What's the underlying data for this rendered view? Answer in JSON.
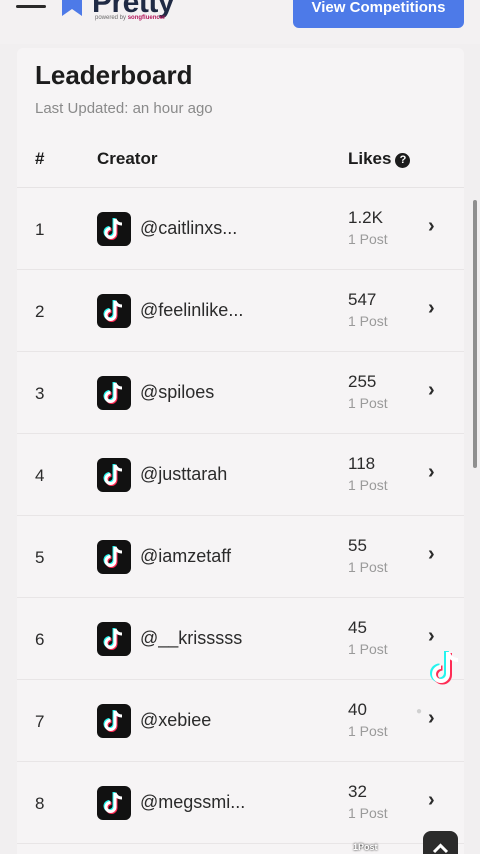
{
  "header": {
    "logo_text": "Pretty",
    "logo_sub_prefix": "powered by",
    "logo_sub_brand": "songfluencer",
    "view_button": "View Competitions"
  },
  "leaderboard": {
    "title": "Leaderboard",
    "updated": "Last Updated: an hour ago",
    "columns": {
      "rank": "#",
      "creator": "Creator",
      "likes": "Likes"
    },
    "rows": [
      {
        "rank": "1",
        "creator": "@caitlinxs...",
        "likes": "1.2K",
        "posts": "1 Post"
      },
      {
        "rank": "2",
        "creator": "@feelinlike...",
        "likes": "547",
        "posts": "1 Post"
      },
      {
        "rank": "3",
        "creator": "@spiloes",
        "likes": "255",
        "posts": "1 Post"
      },
      {
        "rank": "4",
        "creator": "@justtarah",
        "likes": "118",
        "posts": "1 Post"
      },
      {
        "rank": "5",
        "creator": "@iamzetaff",
        "likes": "55",
        "posts": "1 Post"
      },
      {
        "rank": "6",
        "creator": "@__krisssss",
        "likes": "45",
        "posts": "1 Post"
      },
      {
        "rank": "7",
        "creator": "@xebiee",
        "likes": "40",
        "posts": "1 Post"
      },
      {
        "rank": "8",
        "creator": "@megssmi...",
        "likes": "32",
        "posts": "1 Post"
      }
    ]
  },
  "overlay": {
    "post_label": "1Post"
  },
  "icons": {
    "menu": "hamburger-icon",
    "logo": "bookmark-flag-icon",
    "platform": "tiktok-icon",
    "row_action": "chevron-right-icon",
    "help": "question-circle-icon",
    "scroll_top": "chevron-up-icon"
  },
  "colors": {
    "accent": "#4d7ae8",
    "brand": "#b3195c"
  }
}
